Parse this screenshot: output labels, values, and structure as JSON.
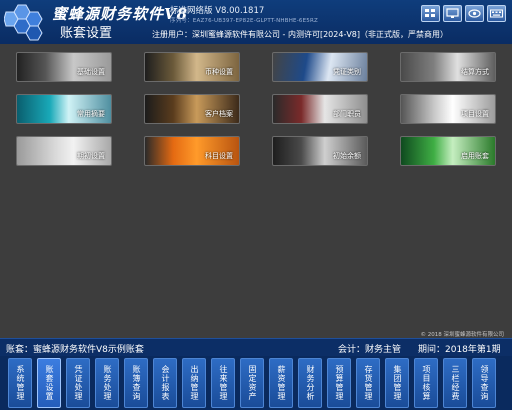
{
  "header": {
    "brand": "蜜蜂源财务软件V8",
    "version": "标准网络版 V8.00.1817",
    "serial": "序列号：EAZ76-UB397-EP82E-GLPTT-NHBHE-6E5RZ",
    "page_title": "账套设置",
    "registration": "注册用户：深圳蜜蜂源软件有限公司 - 内测许可[2024-V8]（非正式版，严禁商用）",
    "top_icons": [
      "grid-view-icon",
      "monitor-icon",
      "eye-icon",
      "keyboard-icon"
    ]
  },
  "tiles": [
    {
      "label": "基础设置"
    },
    {
      "label": "币种设置"
    },
    {
      "label": "凭证类别"
    },
    {
      "label": "结算方式"
    },
    {
      "label": "常用摘要"
    },
    {
      "label": "客户档案"
    },
    {
      "label": "部门职员"
    },
    {
      "label": "项目设置"
    },
    {
      "label": "期初设置"
    },
    {
      "label": "科目设置"
    },
    {
      "label": "初始余额"
    },
    {
      "label": "启用账套"
    }
  ],
  "copyright": "© 2018 深圳蜜蜂源软件有限公司",
  "status": {
    "account": "账套：蜜蜂源财务软件V8示例账套",
    "accountant": "会计：财务主管",
    "period": "期间：2018年第1期"
  },
  "toolbar": [
    {
      "label": "系统管理"
    },
    {
      "label": "账套设置"
    },
    {
      "label": "凭证处理"
    },
    {
      "label": "账务处理"
    },
    {
      "label": "账簿查询"
    },
    {
      "label": "会计报表"
    },
    {
      "label": "出纳管理"
    },
    {
      "label": "往来管理"
    },
    {
      "label": "固定资产"
    },
    {
      "label": "薪资管理"
    },
    {
      "label": "财务分析"
    },
    {
      "label": "预算管理"
    },
    {
      "label": "存货管理"
    },
    {
      "label": "集团管理"
    },
    {
      "label": "项目核算"
    },
    {
      "label": "三栏经费"
    },
    {
      "label": "领导查询"
    }
  ],
  "colors": {
    "header_bg": "#0f3d7c",
    "status_bg": "#0c2e66",
    "tool_bg": "#2e6cc4",
    "canvas_bg": "#3d3d3d"
  }
}
